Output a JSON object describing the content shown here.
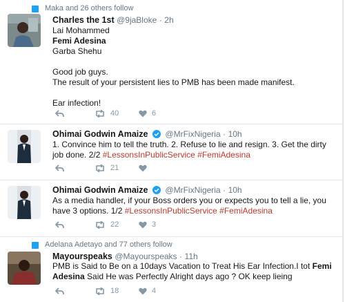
{
  "tweets": [
    {
      "context": "Maka and 26 others follow",
      "name": "Charles the 1st",
      "handle": "@9jaBloke",
      "time": "2h",
      "lines": [
        "Lai Mohammed",
        "Femi Adesina",
        "Garba Shehu",
        "",
        "Good job guys.",
        "The result of your persistent lies to  PMB has been made manifest.",
        "",
        "Ear infection!"
      ],
      "retweets": "40",
      "likes": "6"
    },
    {
      "name": "Ohimai Godwin Amaize",
      "handle": "@MrFixNigeria",
      "time": "10h",
      "text_plain": "1. Convince him to tell the truth. 2. Refuse to lie and resign. 3. Get the dirty job done. 2/2 ",
      "hashtags": [
        "#LessonsInPublicService",
        "#FemiAdesina"
      ],
      "retweets": "21",
      "likes": ""
    },
    {
      "name": "Ohimai Godwin Amaize",
      "handle": "@MrFixNigeria",
      "time": "10h",
      "text_plain": "As a media handler, if your Boss orders you or expects you to tell a lie, you have 3 options. 1/2 ",
      "hashtags": [
        "#LessonsInPublicService",
        "#FemiAdesina"
      ],
      "retweets": "22",
      "likes": "3"
    },
    {
      "context": "Adelana Adetayo and 77 others follow",
      "name": "Mayourspeaks",
      "handle": "@Mayourspeaks",
      "time": "11h",
      "text_part1": "PMB is Said to Be on a 10days Vacation to Treat His Ear Infection.I tot ",
      "text_bold1": "Femi",
      "text_bold2": "Adesina",
      "text_part2": " Said He was Perfectly Alright days ago ? OK keep lieing",
      "retweets": "18",
      "likes": "4"
    }
  ],
  "separator": "·",
  "colors": {
    "accent": "#1da1f2",
    "hashtag": "#c0392b",
    "muted": "#657786",
    "icon": "#8899a6"
  }
}
